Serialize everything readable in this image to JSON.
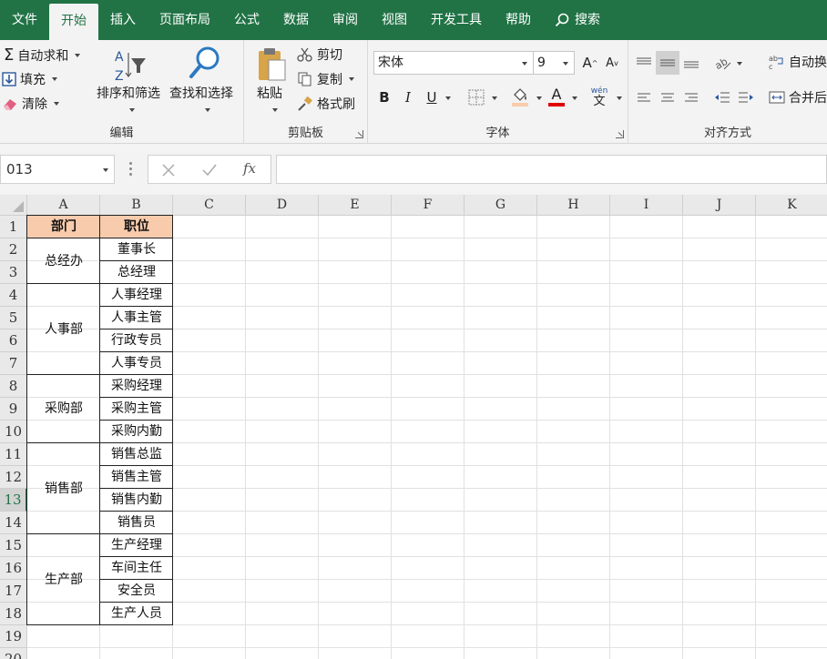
{
  "tabs": [
    "文件",
    "开始",
    "插入",
    "页面布局",
    "公式",
    "数据",
    "审阅",
    "视图",
    "开发工具",
    "帮助",
    "搜索"
  ],
  "active_tab": "开始",
  "ribbon": {
    "editing": {
      "label": "编辑",
      "autosum": "自动求和",
      "fill": "填充",
      "clear": "清除",
      "sort_filter": "排序和筛选",
      "find_select": "查找和选择"
    },
    "clipboard": {
      "label": "剪贴板",
      "paste": "粘贴",
      "cut": "剪切",
      "copy": "复制",
      "format_painter": "格式刷"
    },
    "font": {
      "label": "字体",
      "font_name": "宋体",
      "font_size": "9",
      "bold": "B",
      "italic": "I",
      "underline": "U",
      "font_color_letter": "A",
      "phonetic": "wén",
      "font_color": "#e00000",
      "fill_color": "#f8cbad"
    },
    "alignment": {
      "label": "对齐方式",
      "wrap": "自动换",
      "merge": "合并后"
    }
  },
  "formula_bar": {
    "name_box": "013",
    "fx": "fx",
    "formula": ""
  },
  "sheet": {
    "columns": [
      "A",
      "B",
      "C",
      "D",
      "E",
      "F",
      "G",
      "H",
      "I",
      "J",
      "K"
    ],
    "rows": [
      "1",
      "2",
      "3",
      "4",
      "5",
      "6",
      "7",
      "8",
      "9",
      "10",
      "11",
      "12",
      "13",
      "14",
      "15",
      "16",
      "17",
      "18",
      "19",
      "20"
    ],
    "selected_row": "13",
    "header": {
      "dept": "部门",
      "position": "职位"
    },
    "departments": [
      {
        "name": "总经办",
        "positions": [
          "董事长",
          "总经理"
        ]
      },
      {
        "name": "人事部",
        "positions": [
          "人事经理",
          "人事主管",
          "行政专员",
          "人事专员"
        ]
      },
      {
        "name": "采购部",
        "positions": [
          "采购经理",
          "采购主管",
          "采购内勤"
        ]
      },
      {
        "name": "销售部",
        "positions": [
          "销售总监",
          "销售主管",
          "销售内勤",
          "销售员"
        ]
      },
      {
        "name": "生产部",
        "positions": [
          "生产经理",
          "车间主任",
          "安全员",
          "生产人员"
        ]
      }
    ],
    "header_fill": "#f8cbad",
    "accent": "#217346"
  }
}
